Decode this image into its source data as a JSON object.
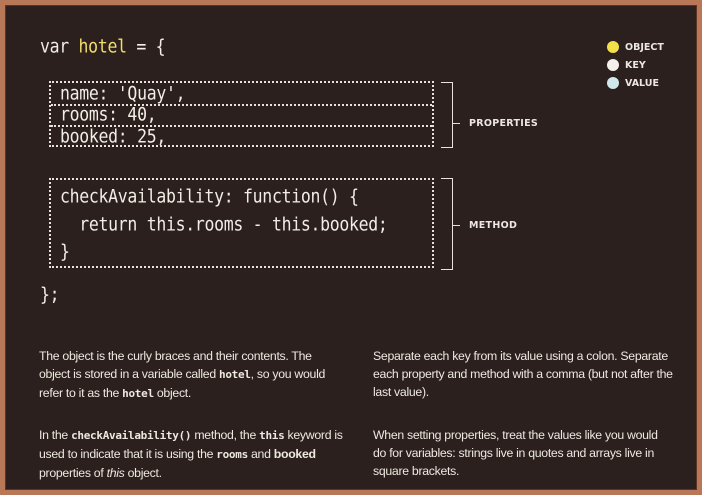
{
  "code": {
    "line1_pre": "var ",
    "line1_obj": "hotel",
    "line1_post": " = {",
    "prop1": "name: 'Quay',",
    "prop2": "rooms: 40,",
    "prop3": "booked: 25,",
    "method1": "checkAvailability: function() {",
    "method2": "  return this.rooms - this.booked;",
    "method3": "}",
    "close": "};"
  },
  "labels": {
    "properties": "PROPERTIES",
    "method": "METHOD"
  },
  "legend": [
    {
      "label": "OBJECT",
      "color": "#f2e04a"
    },
    {
      "label": "KEY",
      "color": "#f4f1ec"
    },
    {
      "label": "VALUE",
      "color": "#cfe9ec"
    }
  ],
  "notes": {
    "n1": {
      "a": "The object is the curly braces and their contents. The object is stored in a variable called ",
      "b": "hotel",
      "c": ", so you would refer to it as the ",
      "d": "hotel",
      "e": " object."
    },
    "n2": "Separate each key from its value using a colon. Separate each property and method with a comma (but not after the last value).",
    "n3": {
      "a": "In the ",
      "b": "checkAvailability()",
      "c": " method, the ",
      "d": "this",
      "e": " keyword is used to indicate that it is using the ",
      "f": "rooms",
      "g": " and ",
      "h": "booked",
      "i": " properties of ",
      "j": "this",
      "k": " object."
    },
    "n4": "When setting properties, treat the values like you would do for variables: strings live in quotes and arrays live in square brackets."
  }
}
